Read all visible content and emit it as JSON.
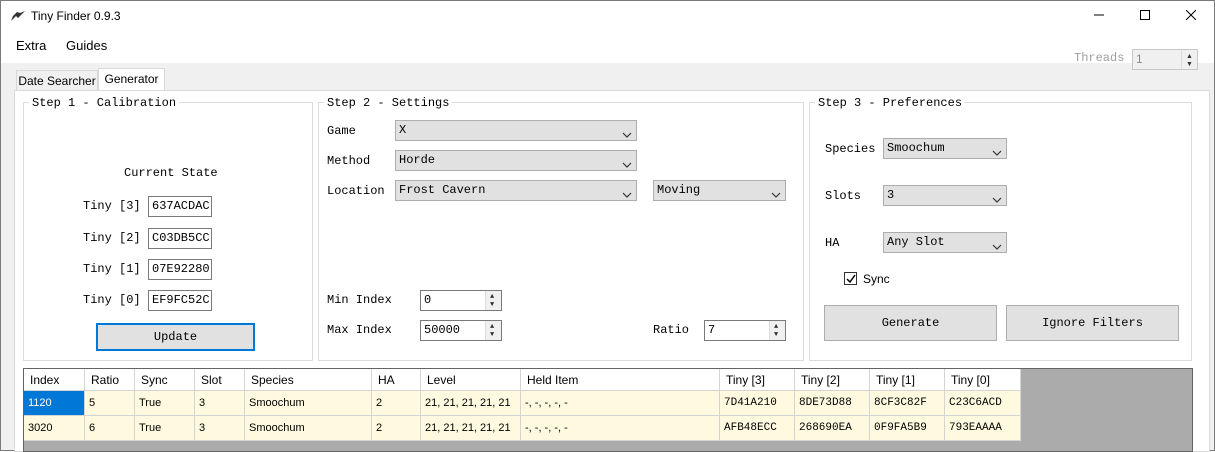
{
  "window": {
    "title": "Tiny Finder 0.9.3"
  },
  "menu": {
    "items": [
      "Extra",
      "Guides"
    ]
  },
  "threads": {
    "label": "Threads",
    "value": "1"
  },
  "tabs": [
    "Date Searcher",
    "Generator"
  ],
  "step1": {
    "title": "Step 1 - Calibration",
    "current_state": "Current State",
    "rows": [
      {
        "label": "Tiny [3]",
        "value": "637ACDAC"
      },
      {
        "label": "Tiny [2]",
        "value": "C03DB5CC"
      },
      {
        "label": "Tiny [1]",
        "value": "07E92280"
      },
      {
        "label": "Tiny [0]",
        "value": "EF9FC52C"
      }
    ],
    "update_label": "Update"
  },
  "step2": {
    "title": "Step 2 - Settings",
    "game_label": "Game",
    "game_value": "X",
    "method_label": "Method",
    "method_value": "Horde",
    "location_label": "Location",
    "location_value": "Frost Cavern",
    "movement_value": "Moving",
    "min_label": "Min Index",
    "min_value": "0",
    "max_label": "Max Index",
    "max_value": "50000",
    "ratio_label": "Ratio",
    "ratio_value": "7"
  },
  "step3": {
    "title": "Step 3 - Preferences",
    "species_label": "Species",
    "species_value": "Smoochum",
    "slots_label": "Slots",
    "slots_value": "3",
    "ha_label": "HA",
    "ha_value": "Any Slot",
    "sync_label": "Sync",
    "generate_label": "Generate",
    "ignore_label": "Ignore Filters"
  },
  "grid": {
    "columns": [
      "Index",
      "Ratio",
      "Sync",
      "Slot",
      "Species",
      "HA",
      "Level",
      "Held Item",
      "Tiny [3]",
      "Tiny [2]",
      "Tiny [1]",
      "Tiny [0]"
    ],
    "rows": [
      [
        "1120",
        "5",
        "True",
        "3",
        "Smoochum",
        "2",
        "21, 21, 21, 21, 21",
        "-, -, -, -, -",
        "7D41A210",
        "8DE73D88",
        "8CF3C82F",
        "C23C6ACD"
      ],
      [
        "3020",
        "6",
        "True",
        "3",
        "Smoochum",
        "2",
        "21, 21, 21, 21, 21",
        "-, -, -, -, -",
        "AFB48ECC",
        "268690EA",
        "0F9FA5B9",
        "793EAAAA"
      ]
    ]
  }
}
